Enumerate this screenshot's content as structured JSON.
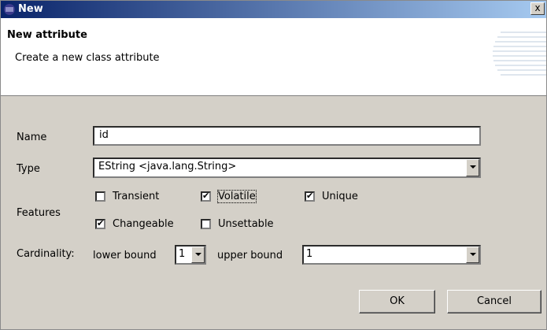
{
  "window": {
    "title": "New",
    "close_label": "x"
  },
  "banner": {
    "title": "New attribute",
    "description": "Create a new class attribute"
  },
  "form": {
    "name_label": "Name",
    "name_value": "id",
    "type_label": "Type",
    "type_value": "EString <java.lang.String>",
    "features_label": "Features",
    "features": [
      {
        "label": "Transient",
        "checked": false
      },
      {
        "label": "Volatile",
        "checked": true
      },
      {
        "label": "Unique",
        "checked": true
      },
      {
        "label": "Changeable",
        "checked": true
      },
      {
        "label": "Unsettable",
        "checked": false
      }
    ],
    "cardinality_label": "Cardinality:",
    "lower_bound_label": "lower bound",
    "lower_bound_value": "1",
    "upper_bound_label": "upper bound",
    "upper_bound_value": "1"
  },
  "buttons": {
    "ok": "OK",
    "cancel": "Cancel"
  },
  "colors": {
    "title_bar_start": "#0a246a",
    "title_bar_end": "#a6caf0",
    "dialog_bg": "#d4d0c8"
  }
}
